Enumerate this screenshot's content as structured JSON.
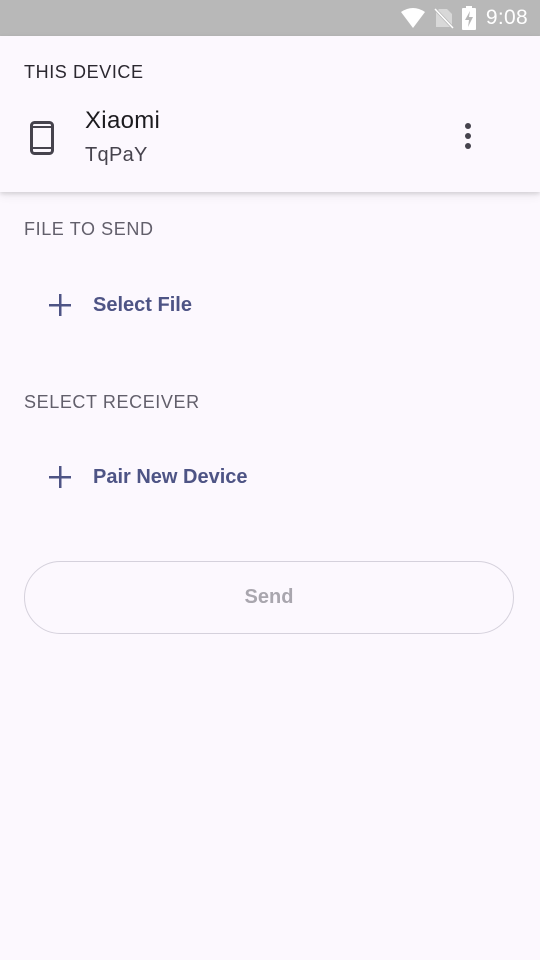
{
  "status_bar": {
    "time": "9:08",
    "icons": [
      "wifi-icon",
      "no-sim-icon",
      "battery-charging-icon"
    ]
  },
  "this_device": {
    "section_title": "THIS DEVICE",
    "icon": "smartphone-icon",
    "name": "Xiaomi",
    "id": "TqPaY",
    "menu_icon": "more-vertical-icon"
  },
  "file_to_send": {
    "section_title": "FILE TO SEND",
    "action_icon": "plus-icon",
    "action_label": "Select File"
  },
  "select_receiver": {
    "section_title": "SELECT RECEIVER",
    "action_icon": "plus-icon",
    "action_label": "Pair New Device"
  },
  "send_button": {
    "label": "Send",
    "enabled": false
  },
  "colors": {
    "background": "#fcf8fe",
    "status_bar": "#b8b8b8",
    "accent": "#4e5485",
    "disabled_text": "#a9a6ae"
  }
}
